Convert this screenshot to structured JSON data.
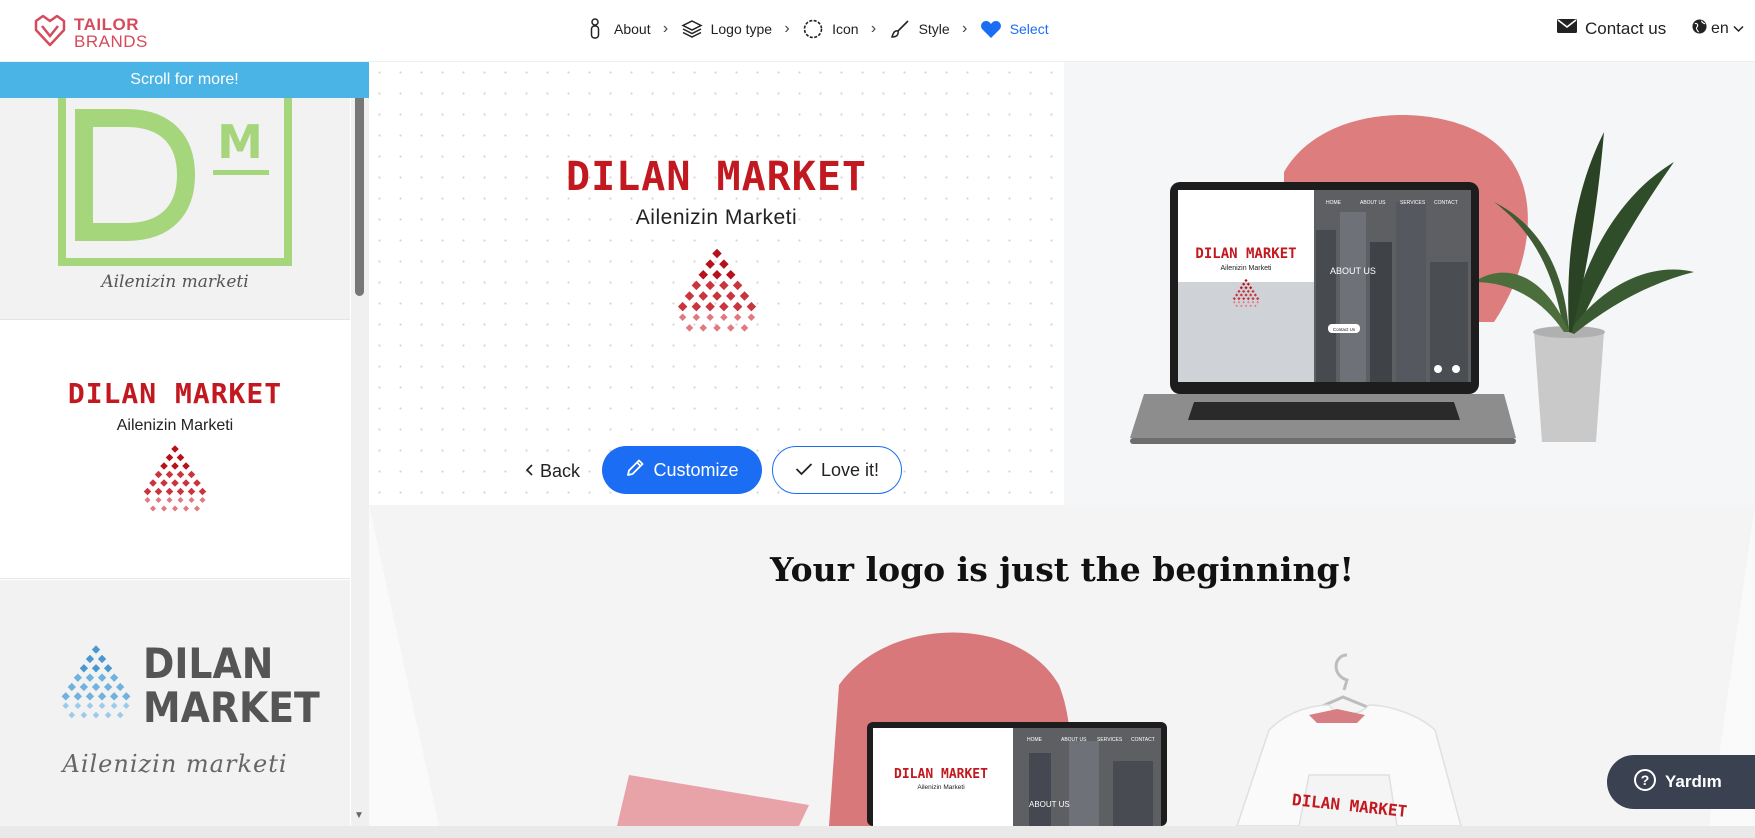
{
  "brand": {
    "line1": "TAILOR",
    "line2": "BRANDS"
  },
  "steps": [
    {
      "label": "About",
      "icon": "person-icon"
    },
    {
      "label": "Logo type",
      "icon": "layers-icon"
    },
    {
      "label": "Icon",
      "icon": "circle-dashed-icon"
    },
    {
      "label": "Style",
      "icon": "brush-icon"
    },
    {
      "label": "Select",
      "icon": "heart-icon"
    }
  ],
  "contact_label": "Contact us",
  "lang": "en",
  "sidebar": {
    "banner": "Scroll for more!",
    "card1": {
      "tagline": "Ailenizin marketi",
      "letters": "D",
      "superscript": "M"
    },
    "card2": {
      "title": "DILAN MARKET",
      "tagline": "Ailenizin Marketi"
    },
    "card3": {
      "title1": "DILAN",
      "title2": "MARKET",
      "tagline": "Ailenizin marketi"
    }
  },
  "preview": {
    "title": "DILAN MARKET",
    "tagline": "Ailenizin Marketi"
  },
  "actions": {
    "back": "Back",
    "customize": "Customize",
    "love": "Love it!"
  },
  "mockup": {
    "nav": [
      "HOME",
      "ABOUT US",
      "SERVICES",
      "CONTACT"
    ],
    "title": "DILAN MARKET",
    "tagline": "Ailenizin Marketi",
    "section": "ABOUT US",
    "cta": "Contact Us"
  },
  "lower": {
    "heading": "Your logo is just the beginning!"
  },
  "help": {
    "label": "Yardım"
  },
  "colors": {
    "accent": "#1b6ef3",
    "logo_red": "#c1191f",
    "brand": "#d64b5c",
    "banner": "#4bb4e6"
  }
}
